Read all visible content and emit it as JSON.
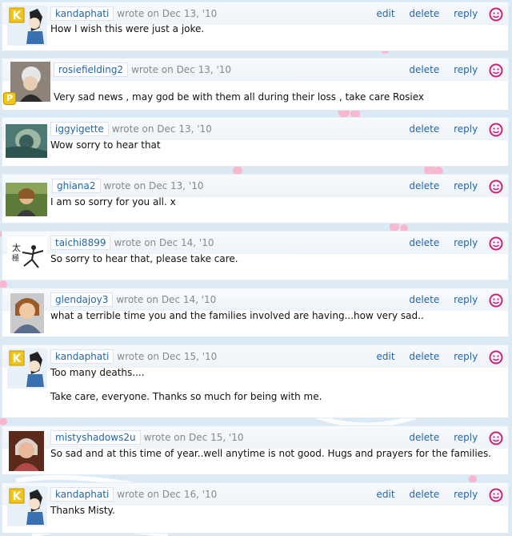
{
  "actions": {
    "edit": "edit",
    "delete": "delete",
    "reply": "reply"
  },
  "comments": [
    {
      "user": "kandaphati",
      "wrote": "wrote on Dec 13, '10",
      "lines": [
        "How I wish this were just a joke."
      ]
    },
    {
      "user": "rosiefielding2",
      "wrote": "wrote on Dec 13, '10",
      "lines": [
        "Very sad news , may god be with them all during their loss , take care Rosiex"
      ],
      "badge": "P"
    },
    {
      "user": "iggyigette",
      "wrote": "wrote on Dec 13, '10",
      "lines": [
        "Wow sorry to hear that"
      ]
    },
    {
      "user": "ghiana2",
      "wrote": "wrote on Dec 13, '10",
      "lines": [
        "I am so sorry for you all. x"
      ]
    },
    {
      "user": "taichi8899",
      "wrote": "wrote on Dec 14, '10",
      "lines": [
        "So sorry to hear that, please take care."
      ]
    },
    {
      "user": "glendajoy3",
      "wrote": "wrote on Dec 14, '10",
      "lines": [
        "what a terrible time you and the families involved are having...how very sad.."
      ]
    },
    {
      "user": "kandaphati",
      "wrote": "wrote on Dec 15, '10",
      "lines": [
        "Too many deaths....",
        "Take care, everyone. Thanks so much for being with me."
      ]
    },
    {
      "user": "mistyshadows2u",
      "wrote": "wrote on Dec 15, '10",
      "lines": [
        "So sad and at this time of year..well anytime is not good. Hugs and prayers for the families."
      ]
    },
    {
      "user": "kandaphati",
      "wrote": "wrote on Dec 16, '10",
      "lines": [
        "Thanks Misty."
      ]
    }
  ],
  "colors": {
    "link": "#2266aa",
    "meta": "#888888",
    "smiley": "#cc2277"
  }
}
